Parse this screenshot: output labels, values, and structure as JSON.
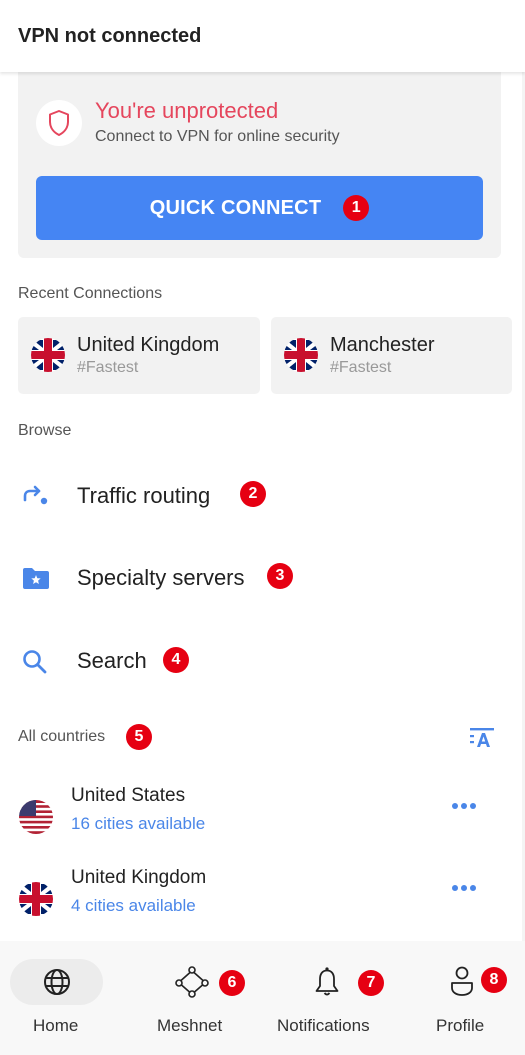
{
  "header": {
    "title": "VPN not connected"
  },
  "status": {
    "icon": "shield-icon",
    "title": "You're unprotected",
    "subtitle": "Connect to VPN for online security",
    "quick_connect_label": "QUICK CONNECT",
    "quick_connect_badge": "1"
  },
  "colors": {
    "accent": "#4585f3",
    "warning": "#e5465d",
    "badge": "#e60012",
    "link": "#4a86e8"
  },
  "recent": {
    "label": "Recent Connections",
    "items": [
      {
        "name": "United Kingdom",
        "sub": "#Fastest",
        "flag": "uk-flag-icon"
      },
      {
        "name": "Manchester",
        "sub": "#Fastest",
        "flag": "uk-flag-icon"
      }
    ]
  },
  "browse": {
    "label": "Browse",
    "items": [
      {
        "label": "Traffic routing",
        "icon": "traffic-routing-icon",
        "badge": "2"
      },
      {
        "label": "Specialty servers",
        "icon": "folder-star-icon",
        "badge": "3"
      },
      {
        "label": "Search",
        "icon": "search-icon",
        "badge": "4"
      }
    ]
  },
  "countries": {
    "label": "All countries",
    "badge": "5",
    "sort_icon": "sort-alpha-icon",
    "items": [
      {
        "name": "United States",
        "cities": "16 cities available",
        "flag": "us-flag-icon"
      },
      {
        "name": "United Kingdom",
        "cities": "4 cities available",
        "flag": "uk-flag-icon"
      }
    ]
  },
  "nav": {
    "items": [
      {
        "label": "Home",
        "icon": "globe-icon",
        "active": true
      },
      {
        "label": "Meshnet",
        "icon": "meshnet-icon",
        "badge": "6"
      },
      {
        "label": "Notifications",
        "icon": "bell-icon",
        "badge": "7"
      },
      {
        "label": "Profile",
        "icon": "profile-icon",
        "badge": "8"
      }
    ]
  }
}
